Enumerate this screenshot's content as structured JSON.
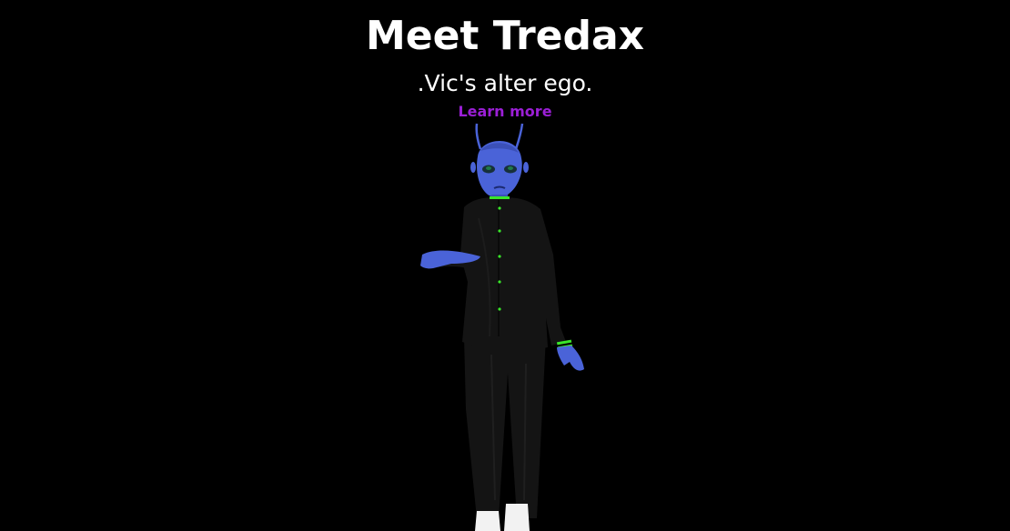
{
  "hero": {
    "title": "Meet Tredax",
    "subtitle": ".Vic's alter ego.",
    "learn_more_label": "Learn more"
  },
  "colors": {
    "background": "#000000",
    "text": "#ffffff",
    "link": "#9b1fd6",
    "skin": "#4a63d8",
    "suit": "#141414",
    "accent_green": "#39e62a"
  },
  "illustration": {
    "subject": "tredax-character-illustration"
  }
}
